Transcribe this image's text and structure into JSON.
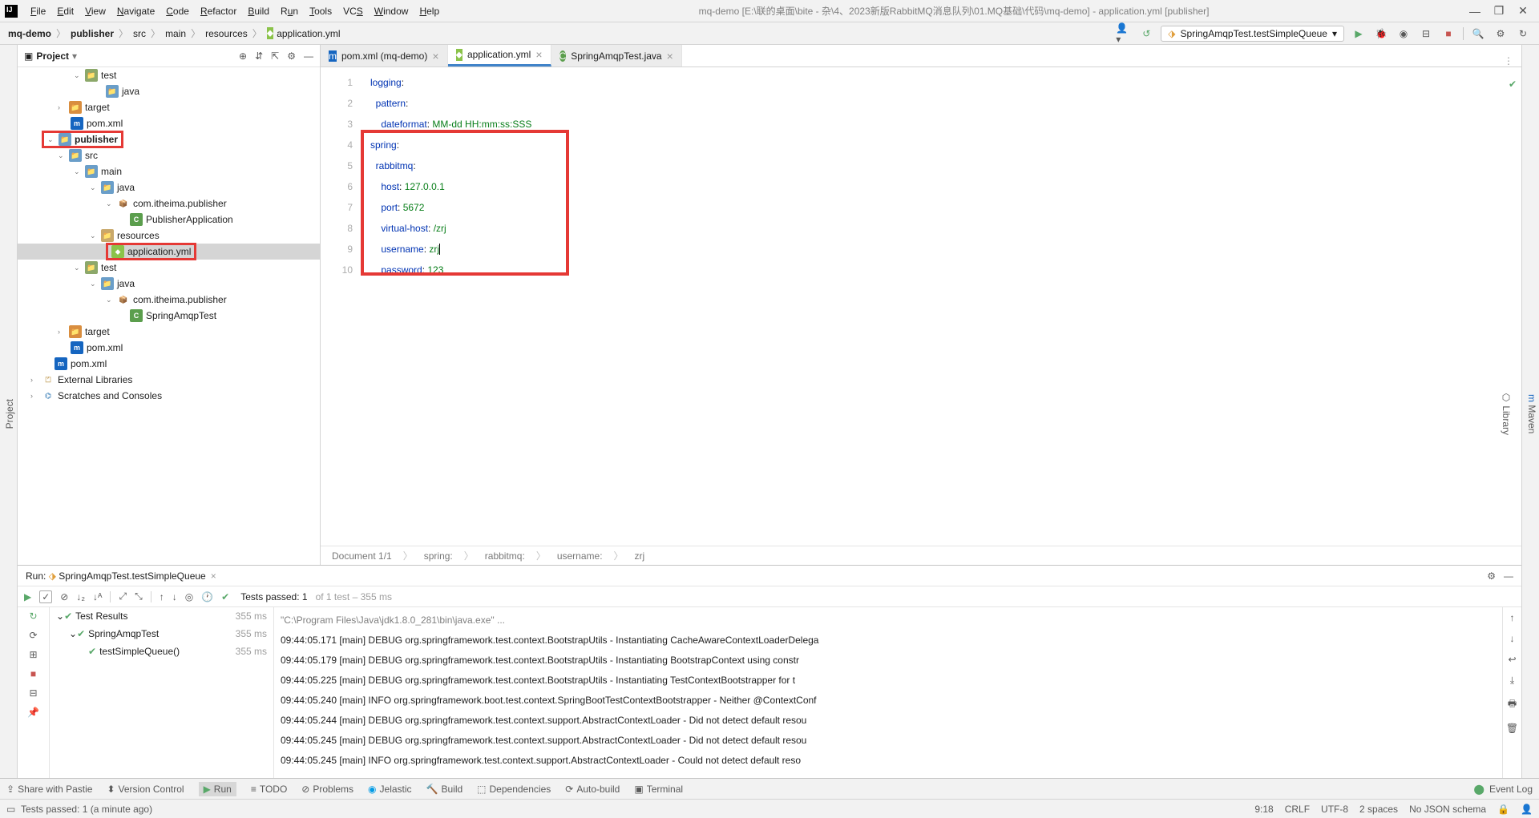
{
  "menu": {
    "file": "File",
    "edit": "Edit",
    "view": "View",
    "navigate": "Navigate",
    "code": "Code",
    "refactor": "Refactor",
    "build": "Build",
    "run": "Run",
    "tools": "Tools",
    "vcs": "VCS",
    "window": "Window",
    "help": "Help"
  },
  "windowTitle": "mq-demo [E:\\联的桌面\\bite - 杂\\4、2023新版RabbitMQ消息队列\\01.MQ基础\\代码\\mq-demo] - application.yml [publisher]",
  "nav": {
    "root": "mq-demo",
    "p1": "publisher",
    "p2": "src",
    "p3": "main",
    "p4": "resources",
    "file": "application.yml"
  },
  "runConfig": "SpringAmqpTest.testSimpleQueue",
  "projectTitle": "Project",
  "tree": {
    "test": "test",
    "java": "java",
    "target": "target",
    "pom": "pom.xml",
    "publisher": "publisher",
    "src": "src",
    "main": "main",
    "pkg": "com.itheima.publisher",
    "app": "PublisherApplication",
    "resources": "resources",
    "yml": "application.yml",
    "test2": "test",
    "java2": "java",
    "pkg2": "com.itheima.publisher",
    "testcls": "SpringAmqpTest",
    "target2": "target",
    "pom2": "pom.xml",
    "pom3": "pom.xml",
    "ext": "External Libraries",
    "scratch": "Scratches and Consoles"
  },
  "tabs": {
    "t1": "pom.xml (mq-demo)",
    "t2": "application.yml",
    "t3": "SpringAmqpTest.java"
  },
  "code": {
    "l1k": "logging",
    "l2k": "pattern",
    "l3k": "dateformat",
    "l3v": "MM-dd HH:mm:ss:SSS",
    "l4k": "spring",
    "l5k": "rabbitmq",
    "l6k": "host",
    "l6v": "127.0.0.1",
    "l7k": "port",
    "l7v": "5672",
    "l8k": "virtual-host",
    "l8v": "/zrj",
    "l9k": "username",
    "l9v": "zrj",
    "l10k": "password",
    "l10v": "123"
  },
  "breadcrumb": {
    "doc": "Document 1/1",
    "b1": "spring:",
    "b2": "rabbitmq:",
    "b3": "username:",
    "b4": "zrj"
  },
  "runTab": {
    "label": "Run:",
    "name": "SpringAmqpTest.testSimpleQueue"
  },
  "testSummary": {
    "passed": "Tests passed: 1",
    "of": " of 1 test – 355 ms"
  },
  "testTree": {
    "root": "Test Results",
    "t1": "SpringAmqpTest",
    "t2": "testSimpleQueue()",
    "time": "355 ms"
  },
  "console": {
    "l1": "\"C:\\Program Files\\Java\\jdk1.8.0_281\\bin\\java.exe\" ...",
    "l2": "09:44:05.171 [main] DEBUG org.springframework.test.context.BootstrapUtils - Instantiating CacheAwareContextLoaderDelega",
    "l3": "09:44:05.179 [main] DEBUG org.springframework.test.context.BootstrapUtils - Instantiating BootstrapContext using constr",
    "l4": "09:44:05.225 [main] DEBUG org.springframework.test.context.BootstrapUtils - Instantiating TestContextBootstrapper for t",
    "l5": "09:44:05.240 [main] INFO org.springframework.boot.test.context.SpringBootTestContextBootstrapper - Neither @ContextConf",
    "l6": "09:44:05.244 [main] DEBUG org.springframework.test.context.support.AbstractContextLoader - Did not detect default resou",
    "l7": "09:44:05.245 [main] DEBUG org.springframework.test.context.support.AbstractContextLoader - Did not detect default resou",
    "l8": "09:44:05.245 [main] INFO org.springframework.test.context.support.AbstractContextLoader - Could not detect default reso"
  },
  "bottom": {
    "pastie": "Share with Pastie",
    "vc": "Version Control",
    "run": "Run",
    "todo": "TODO",
    "prob": "Problems",
    "jel": "Jelastic",
    "build": "Build",
    "deps": "Dependencies",
    "auto": "Auto-build",
    "term": "Terminal",
    "evlog": "Event Log"
  },
  "status": {
    "msg": "Tests passed: 1 (a minute ago)",
    "pos": "9:18",
    "crlf": "CRLF",
    "enc": "UTF-8",
    "indent": "2 spaces",
    "schema": "No JSON schema"
  }
}
